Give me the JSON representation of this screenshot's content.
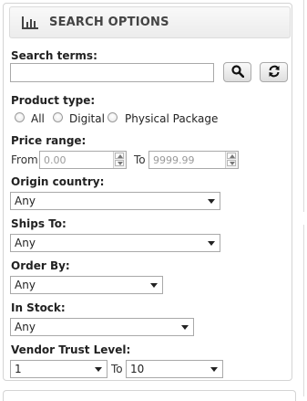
{
  "header": {
    "title": "SEARCH OPTIONS",
    "icon": "bar-chart-icon"
  },
  "search": {
    "label": "Search terms:",
    "value": "",
    "search_icon": "search-icon",
    "reset_icon": "refresh-icon"
  },
  "product_type": {
    "label": "Product type:",
    "options": [
      "All",
      "Digital",
      "Physical Package"
    ],
    "selected": null
  },
  "price": {
    "label": "Price range:",
    "from_label": "From",
    "from_placeholder": "0.00",
    "to_label": "To",
    "to_placeholder": "9999.99"
  },
  "origin": {
    "label": "Origin country:",
    "value": "Any"
  },
  "ships_to": {
    "label": "Ships To:",
    "value": "Any"
  },
  "order_by": {
    "label": "Order By:",
    "value": "Any"
  },
  "in_stock": {
    "label": "In Stock:",
    "value": "Any"
  },
  "vendor_trust": {
    "label": "Vendor Trust Level:",
    "from_value": "1",
    "to_label": "To",
    "to_value": "10"
  },
  "colors": {
    "border": "#d4d4d4",
    "header_bg": "#ececec",
    "text": "#222222"
  }
}
